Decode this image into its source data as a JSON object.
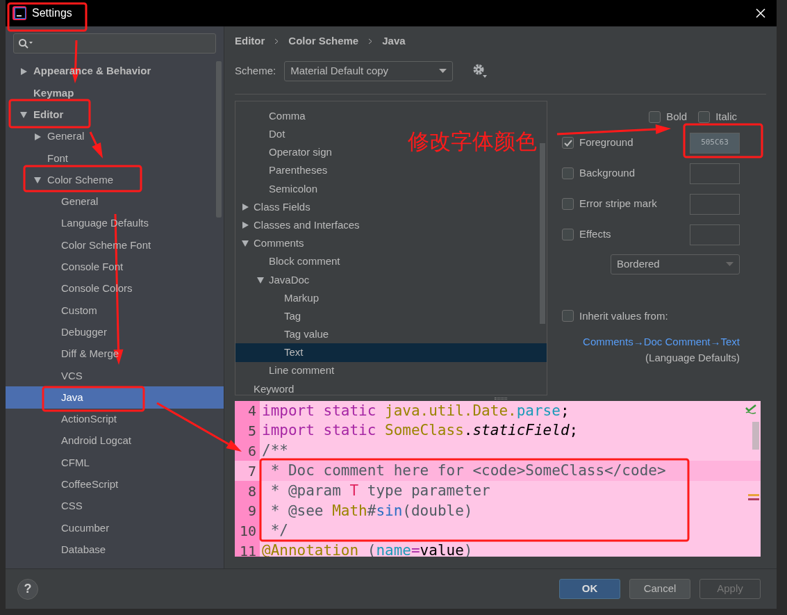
{
  "window": {
    "title": "Settings"
  },
  "sidebar": {
    "items": [
      {
        "label": "Appearance & Behavior",
        "expanded": false,
        "selected": false
      },
      {
        "label": "Keymap",
        "selected": false
      },
      {
        "label": "Editor",
        "expanded": true,
        "selected": false,
        "children": [
          {
            "label": "General",
            "expanded": false,
            "selected": false
          },
          {
            "label": "Font",
            "selected": false
          },
          {
            "label": "Color Scheme",
            "expanded": true,
            "selected": false,
            "children": [
              {
                "label": "General",
                "selected": false
              },
              {
                "label": "Language Defaults",
                "selected": false
              },
              {
                "label": "Color Scheme Font",
                "selected": false
              },
              {
                "label": "Console Font",
                "selected": false
              },
              {
                "label": "Console Colors",
                "selected": false
              },
              {
                "label": "Custom",
                "selected": false
              },
              {
                "label": "Debugger",
                "selected": false
              },
              {
                "label": "Diff & Merge",
                "selected": false
              },
              {
                "label": "VCS",
                "selected": false
              },
              {
                "label": "Java",
                "selected": true
              },
              {
                "label": "ActionScript",
                "selected": false
              },
              {
                "label": "Android Logcat",
                "selected": false
              },
              {
                "label": "CFML",
                "selected": false
              },
              {
                "label": "CoffeeScript",
                "selected": false
              },
              {
                "label": "CSS",
                "selected": false
              },
              {
                "label": "Cucumber",
                "selected": false
              },
              {
                "label": "Database",
                "selected": false
              }
            ]
          }
        ]
      }
    ]
  },
  "breadcrumb": [
    "Editor",
    "Color Scheme",
    "Java"
  ],
  "scheme": {
    "label": "Scheme:",
    "value": "Material Default copy"
  },
  "attributes": {
    "items": [
      {
        "label": "Comma",
        "selected": false,
        "indent": true
      },
      {
        "label": "Dot",
        "selected": false,
        "indent": true
      },
      {
        "label": "Operator sign",
        "selected": false,
        "indent": true
      },
      {
        "label": "Parentheses",
        "selected": false,
        "indent": true
      },
      {
        "label": "Semicolon",
        "selected": false,
        "indent": true
      },
      {
        "label": "Class Fields",
        "expanded": false,
        "selected": false
      },
      {
        "label": "Classes and Interfaces",
        "expanded": false,
        "selected": false
      },
      {
        "label": "Comments",
        "expanded": true,
        "selected": false,
        "children": [
          {
            "label": "Block comment",
            "selected": false
          },
          {
            "label": "JavaDoc",
            "expanded": true,
            "selected": false,
            "children": [
              {
                "label": "Markup",
                "selected": false
              },
              {
                "label": "Tag",
                "selected": false
              },
              {
                "label": "Tag value",
                "selected": false
              },
              {
                "label": "Text",
                "selected": true
              }
            ]
          },
          {
            "label": "Line comment",
            "selected": false
          }
        ]
      },
      {
        "label": "Keyword",
        "selected": false
      }
    ]
  },
  "font_styles": [
    {
      "label": "Bold",
      "checked": false
    },
    {
      "label": "Italic",
      "checked": false
    }
  ],
  "color_options": [
    {
      "label": "Foreground",
      "checked": true,
      "value": "505C63"
    },
    {
      "label": "Background",
      "checked": false
    },
    {
      "label": "Error stripe mark",
      "checked": false
    },
    {
      "label": "Effects",
      "checked": false
    }
  ],
  "effect_type": "Bordered",
  "inherit": {
    "label": "Inherit values from:",
    "checked": false,
    "link": "Comments→Doc Comment→Text",
    "note": "(Language Defaults)"
  },
  "preview": {
    "lines": [
      {
        "number": "4",
        "current": false,
        "tokens": [
          {
            "text": "import static ",
            "color": "#a626a4"
          },
          {
            "text": "java.util.Date.",
            "color": "#9a8400"
          },
          {
            "text": "parse",
            "color": "#1a9bb8"
          },
          {
            "text": ";",
            "color": "#000000"
          }
        ]
      },
      {
        "number": "5",
        "current": false,
        "tokens": [
          {
            "text": "import static ",
            "color": "#a626a4"
          },
          {
            "text": "SomeClass",
            "color": "#9a8400"
          },
          {
            "text": ".*staticField*;",
            "color": "#000000"
          }
        ]
      },
      {
        "number": "6",
        "current": false,
        "tokens": [
          {
            "text": "/**",
            "color": "#505c63"
          }
        ]
      },
      {
        "number": "7",
        "current": true,
        "tokens": [
          {
            "text": " * Doc comment here for <code>SomeClass</code>",
            "color": "#505c63"
          }
        ]
      },
      {
        "number": "8",
        "current": false,
        "tokens": [
          {
            "text": " * @param ",
            "color": "#505c63"
          },
          {
            "text": "T",
            "color": "#e0245e"
          },
          {
            "text": " type parameter",
            "color": "#505c63"
          }
        ]
      },
      {
        "number": "9",
        "current": false,
        "tokens": [
          {
            "text": " * @see ",
            "color": "#505c63"
          },
          {
            "text": "Math",
            "color": "#9a8400"
          },
          {
            "text": "#",
            "color": "#505c63"
          },
          {
            "text": "sin",
            "color": "#2a6fc2"
          },
          {
            "text": "(double)",
            "color": "#505c63"
          }
        ]
      },
      {
        "number": "10",
        "current": false,
        "tokens": [
          {
            "text": " */",
            "color": "#505c63"
          }
        ]
      },
      {
        "number": "11",
        "current": false,
        "tokens": [
          {
            "text": "@Annotation",
            "color": "#9a8400"
          },
          {
            "text": " (",
            "color": "#505c63"
          },
          {
            "text": "name",
            "color": "#1a9bb8"
          },
          {
            "text": "=",
            "color": "#a626a4"
          },
          {
            "text": "value",
            "color": "#000000"
          },
          {
            "text": ")",
            "color": "#505c63"
          }
        ]
      }
    ]
  },
  "buttons": [
    {
      "label": "OK",
      "kind": "primary",
      "disabled": false
    },
    {
      "label": "Cancel",
      "kind": "default",
      "disabled": false
    },
    {
      "label": "Apply",
      "kind": "default",
      "disabled": true
    }
  ],
  "help": {
    "label": "?"
  },
  "annotation": {
    "text": "修改字体颜色"
  }
}
